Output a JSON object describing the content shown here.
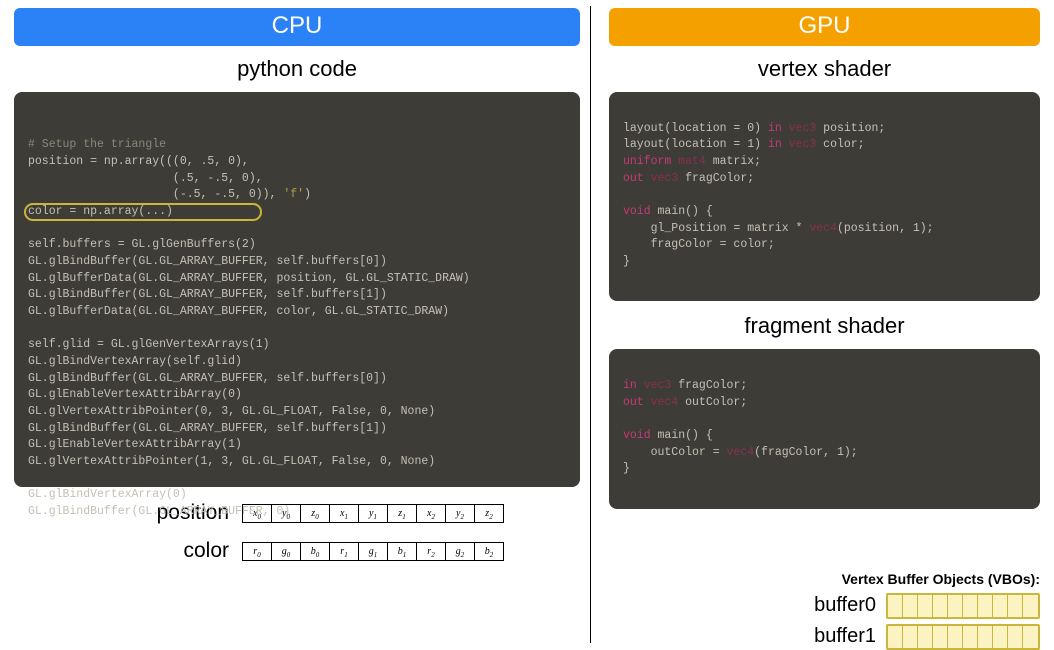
{
  "headers": {
    "cpu": "CPU",
    "gpu": "GPU"
  },
  "sections": {
    "python_title": "python code",
    "vertex_title": "vertex shader",
    "fragment_title": "fragment shader"
  },
  "highlight_line": "self.buffers = GL.glGenBuffers(2)",
  "position_label": "position",
  "color_label": "color",
  "position_cells": [
    "x0",
    "y0",
    "z0",
    "x1",
    "y1",
    "z1",
    "x2",
    "y2",
    "z2"
  ],
  "color_cells": [
    "r0",
    "g0",
    "b0",
    "r1",
    "g1",
    "b1",
    "r2",
    "g2",
    "b2"
  ],
  "vbo_title": "Vertex Buffer Objects (VBOs):",
  "vbo_rows": [
    {
      "label": "buffer0",
      "cells": 10
    },
    {
      "label": "buffer1",
      "cells": 10
    }
  ],
  "python_code": {
    "comment": "# Setup the triangle",
    "l1": "position = np.array(((0, .5, 0),",
    "l2": "                     (.5, -.5, 0),",
    "l3a": "                     (-.5, -.5, 0)), ",
    "l3b": "'f'",
    "l3c": ")",
    "l4": "color = np.array(...)",
    "l5": "",
    "l6": "self.buffers = GL.glGenBuffers(2)",
    "l7": "GL.glBindBuffer(GL.GL_ARRAY_BUFFER, self.buffers[0])",
    "l8": "GL.glBufferData(GL.GL_ARRAY_BUFFER, position, GL.GL_STATIC_DRAW)",
    "l9": "GL.glBindBuffer(GL.GL_ARRAY_BUFFER, self.buffers[1])",
    "l10": "GL.glBufferData(GL.GL_ARRAY_BUFFER, color, GL.GL_STATIC_DRAW)",
    "l11": "",
    "l12": "self.glid = GL.glGenVertexArrays(1)",
    "l13": "GL.glBindVertexArray(self.glid)",
    "l14": "GL.glBindBuffer(GL.GL_ARRAY_BUFFER, self.buffers[0])",
    "l15": "GL.glEnableVertexAttribArray(0)",
    "l16": "GL.glVertexAttribPointer(0, 3, GL.GL_FLOAT, False, 0, None)",
    "l17": "GL.glBindBuffer(GL.GL_ARRAY_BUFFER, self.buffers[1])",
    "l18": "GL.glEnableVertexAttribArray(1)",
    "l19": "GL.glVertexAttribPointer(1, 3, GL.GL_FLOAT, False, 0, None)",
    "l20": "",
    "l21": "GL.glBindVertexArray(0)",
    "l22": "GL.glBindBuffer(GL.GL_ARRAY_BUFFER, 0)"
  },
  "vertex_shader": {
    "l1a": "layout(location = 0) ",
    "l1b": "in ",
    "l1c": "vec3",
    "l1d": " position;",
    "l2a": "layout(location = 1) ",
    "l2b": "in ",
    "l2c": "vec3",
    "l2d": " color;",
    "l3a": "uniform ",
    "l3b": "mat4",
    "l3c": " matrix;",
    "l4a": "out ",
    "l4b": "vec3",
    "l4c": " fragColor;",
    "l5": "",
    "l6a": "void ",
    "l6b": "main() {",
    "l7a": "    gl_Position = matrix * ",
    "l7b": "vec4",
    "l7c": "(position, 1);",
    "l8": "    fragColor = color;",
    "l9": "}"
  },
  "fragment_shader": {
    "l1a": "in ",
    "l1b": "vec3",
    "l1c": " fragColor;",
    "l2a": "out ",
    "l2b": "vec4",
    "l2c": " outColor;",
    "l3": "",
    "l4a": "void ",
    "l4b": "main() {",
    "l5a": "    outColor = ",
    "l5b": "vec4",
    "l5c": "(fragColor, 1);",
    "l6": "}"
  }
}
